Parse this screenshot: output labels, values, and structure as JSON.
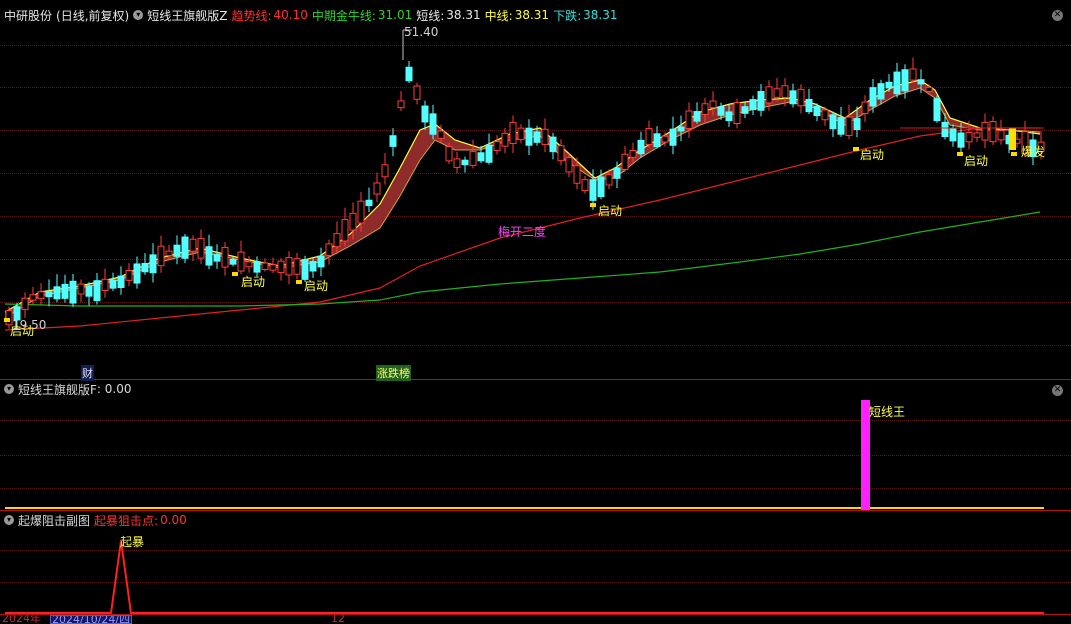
{
  "main_panel": {
    "stock": "中研股份",
    "period": "(日线,前复权)",
    "indicator": "短线王旗舰版Z",
    "values": [
      {
        "label": "趋势线:",
        "value": "40.10",
        "color": "#ff3030"
      },
      {
        "label": "中期金牛线:",
        "value": "31.01",
        "color": "#30d030"
      },
      {
        "label": "短线:",
        "value": "38.31",
        "color": "#e8e8e8"
      },
      {
        "label": "中线:",
        "value": "38.31",
        "color": "#ffff30"
      },
      {
        "label": "下跌:",
        "value": "38.31",
        "color": "#30e0e0"
      }
    ],
    "high_label": "51.40",
    "low_label": "19.50",
    "launch_label": "启动",
    "plum_label": "梅开二度",
    "burst_label": "爆发",
    "tag_finance": "财",
    "tag_limit": "涨跌榜"
  },
  "panel2": {
    "title": "短线王旗舰版F",
    "value": ": 0.00",
    "bar_label": "短线王"
  },
  "panel3": {
    "title": "起爆阻击副图",
    "value_label": "起暴狙击点:",
    "value": "0.00",
    "peak_label": "起暴"
  },
  "footer": {
    "year": "2024年",
    "date": "2024/10/24/四",
    "tick_12": "12"
  },
  "colors": {
    "up": "#ff3c3c",
    "down": "#54ffff",
    "trend": "#e02020",
    "bull": "#20b020",
    "mid": "#ffff40",
    "band": "#a03030"
  }
}
